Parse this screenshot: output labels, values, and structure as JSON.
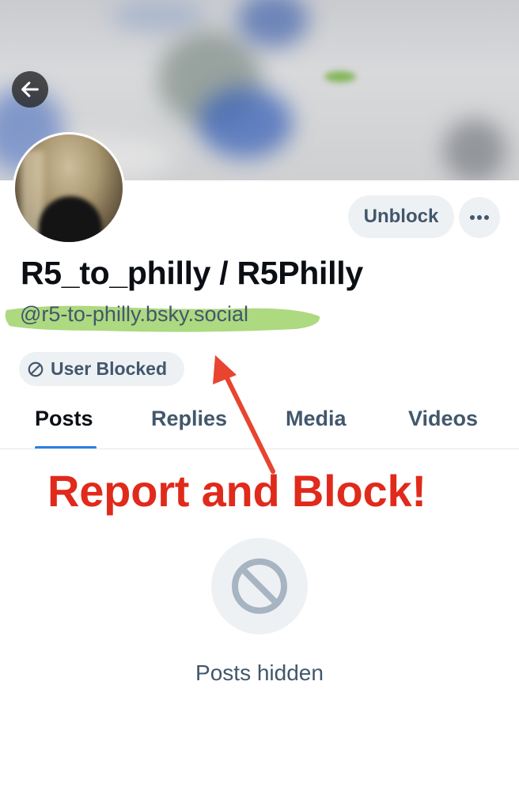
{
  "profile": {
    "display_name": "R5_to_philly / R5Philly",
    "handle": "@r5-to-philly.bsky.social",
    "blocked_label": "User Blocked"
  },
  "actions": {
    "unblock_label": "Unblock",
    "more_icon": "ellipsis-icon",
    "back_icon": "arrow-left-icon"
  },
  "tabs": [
    {
      "label": "Posts",
      "active": true
    },
    {
      "label": "Replies",
      "active": false
    },
    {
      "label": "Media",
      "active": false
    },
    {
      "label": "Videos",
      "active": false
    }
  ],
  "annotation": {
    "text": "Report and Block!",
    "arrow_color": "#e8442f",
    "highlight_color": "#9fd26a"
  },
  "empty_state": {
    "icon": "blocked-icon",
    "text": "Posts hidden"
  },
  "colors": {
    "accent": "#2b7fe0",
    "muted_text": "#42576c",
    "annotation_red": "#e02a1b"
  }
}
